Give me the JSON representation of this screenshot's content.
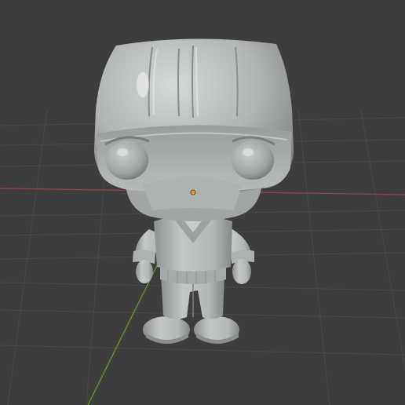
{
  "viewport": {
    "mode": "3d-viewport",
    "shading": "solid",
    "background_color": "#3d3d3d",
    "grid_color": "#4a4a4a",
    "x_axis_color": "#9b3b4a",
    "y_axis_color": "#6b9a2e",
    "origin_color": "#f29a28"
  },
  "object": {
    "kind": "figurine-mesh",
    "surface_color": "#b9bcbd",
    "shadow_color": "#7a7d7e",
    "highlight_color": "#e8eaeb"
  }
}
